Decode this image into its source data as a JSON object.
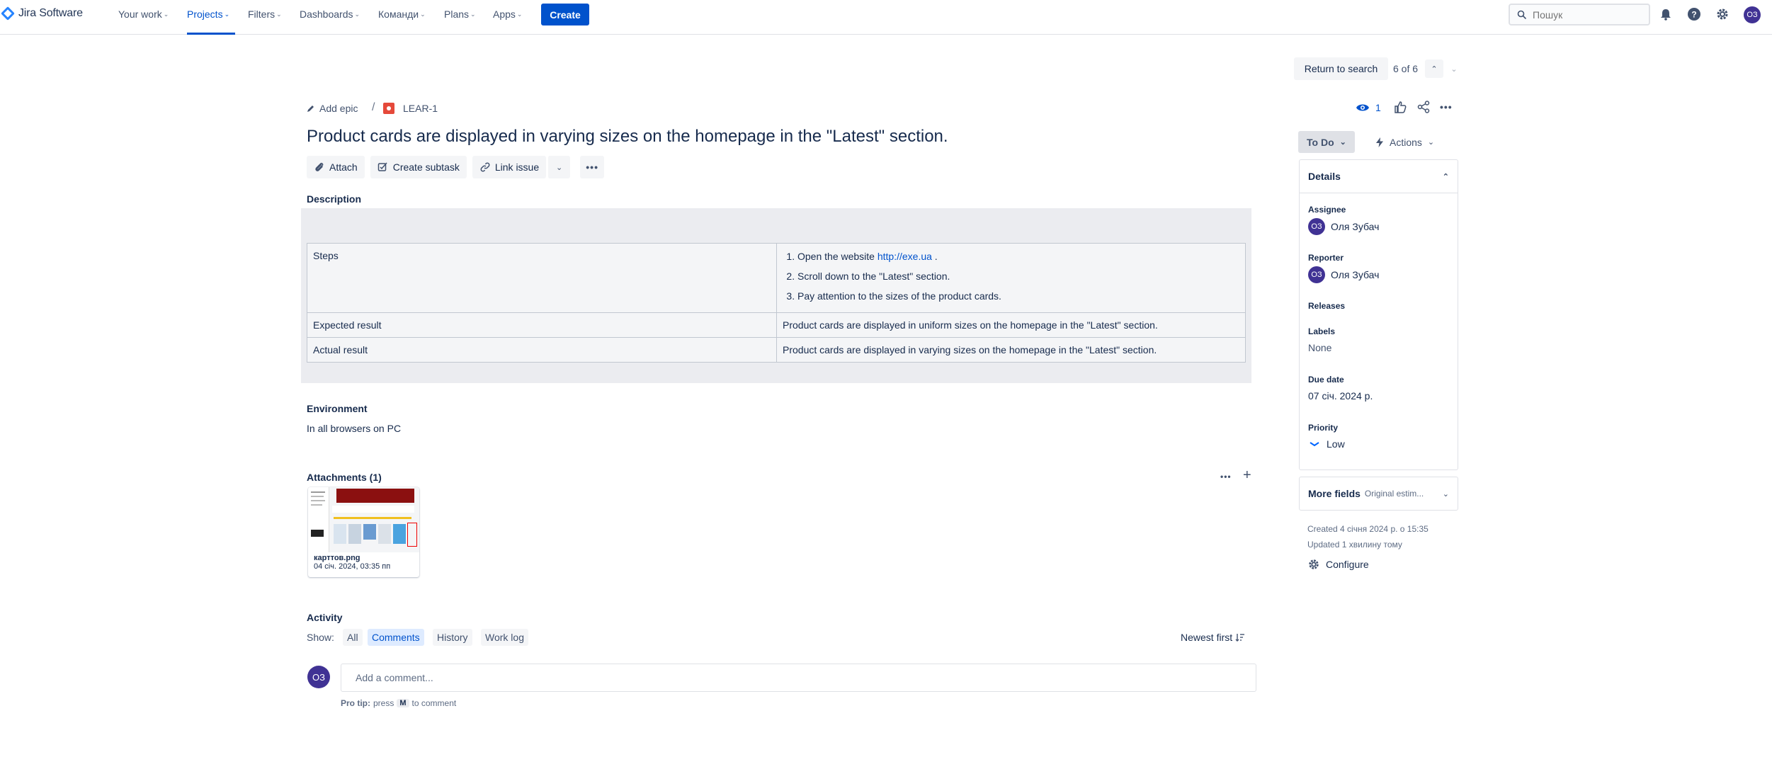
{
  "app": {
    "logo_text": "Jira Software"
  },
  "nav": {
    "items": [
      {
        "label": "Your work"
      },
      {
        "label": "Projects"
      },
      {
        "label": "Filters"
      },
      {
        "label": "Dashboards"
      },
      {
        "label": "Команди"
      },
      {
        "label": "Plans"
      },
      {
        "label": "Apps"
      }
    ],
    "create_label": "Create",
    "search_placeholder": "Пошук",
    "user_initials": "ОЗ"
  },
  "issue_nav": {
    "return_label": "Return to search",
    "counter": "6 of 6"
  },
  "breadcrumb": {
    "add_epic": "Add epic",
    "sep": "/",
    "issue_key": "LEAR-1"
  },
  "issue": {
    "title": "Product cards are displayed in varying sizes on the homepage in the \"Latest\" section.",
    "watchers": "1"
  },
  "toolbar": {
    "attach": "Attach",
    "create_subtask": "Create subtask",
    "link_issue": "Link issue"
  },
  "description": {
    "label": "Description",
    "rows": {
      "steps_label": "Steps",
      "step1_prefix": "Open the website ",
      "step1_link": "http://exe.ua",
      "step1_suffix": " .",
      "step2": "Scroll down to the \"Latest\" section.",
      "step3": "Pay attention to the sizes of the product cards.",
      "expected_label": "Expected result",
      "expected_value": "Product cards are displayed in uniform sizes on the homepage in the \"Latest\" section.",
      "actual_label": "Actual result",
      "actual_value": "Product cards are displayed in varying sizes on the homepage in the \"Latest\" section."
    }
  },
  "environment": {
    "label": "Environment",
    "value": "In all browsers on PC"
  },
  "attachments": {
    "label": "Attachments (1)",
    "file_name": "карттов.png",
    "file_date": "04 січ. 2024, 03:35 пп"
  },
  "activity": {
    "label": "Activity",
    "show_label": "Show:",
    "filters": [
      "All",
      "Comments",
      "History",
      "Work log"
    ],
    "sort_label": "Newest first",
    "comment_placeholder": "Add a comment...",
    "protip_prefix": "Pro tip:",
    "protip_press": "press",
    "protip_key": "M",
    "protip_suffix": "to comment"
  },
  "sidebar": {
    "status": "To Do",
    "actions": "Actions",
    "details_title": "Details",
    "assignee_label": "Assignee",
    "assignee_name": "Оля Зубач",
    "reporter_label": "Reporter",
    "reporter_name": "Оля Зубач",
    "releases_label": "Releases",
    "labels_label": "Labels",
    "labels_value": "None",
    "due_label": "Due date",
    "due_value": "07 січ. 2024 р.",
    "priority_label": "Priority",
    "priority_value": "Low",
    "more_fields_label": "More fields",
    "more_fields_hint": "Original estim...",
    "created": "Created 4 січня 2024 р. о 15:35",
    "updated": "Updated 1 хвилину тому",
    "configure": "Configure"
  },
  "colors": {
    "brand": "#0052cc",
    "avatar": "#403294",
    "bug": "#e5493a"
  }
}
